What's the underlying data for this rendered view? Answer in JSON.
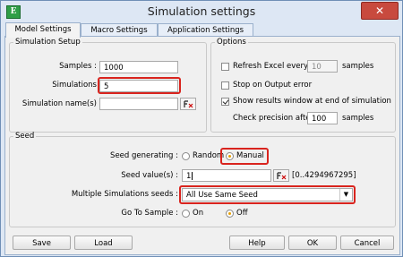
{
  "window": {
    "title": "Simulation settings",
    "app_icon_letter": "E",
    "close_glyph": "✕"
  },
  "tabs": [
    {
      "label": "Model Settings",
      "active": true
    },
    {
      "label": "Macro Settings",
      "active": false
    },
    {
      "label": "Application Settings",
      "active": false
    }
  ],
  "simulation_setup": {
    "legend": "Simulation Setup",
    "samples_label": "Samples :",
    "samples_value": "1000",
    "simulations_label": "Simulations",
    "simulations_value": "5",
    "simulation_names_label": "Simulation name(s)",
    "simulation_names_value": ""
  },
  "options": {
    "legend": "Options",
    "refresh_label": "Refresh Excel every",
    "refresh_checked": false,
    "refresh_value": "10",
    "refresh_unit": "samples",
    "stop_label": "Stop on Output error",
    "stop_checked": false,
    "show_results_label": "Show results window at end of simulation",
    "show_results_checked": true,
    "check_precision_label": "Check precision after",
    "check_precision_value": "100",
    "check_precision_unit": "samples"
  },
  "seed": {
    "legend": "Seed",
    "generating_label": "Seed generating :",
    "random_label": "Random",
    "manual_label": "Manual",
    "selected": "Manual",
    "value_label": "Seed value(s) :",
    "value": "1",
    "range_hint": "[0..4294967295]",
    "multi_label": "Multiple Simulations seeds :",
    "multi_value": "All Use Same Seed",
    "goto_label": "Go To Sample :",
    "on_label": "On",
    "off_label": "Off",
    "goto_selected": "Off"
  },
  "footer": {
    "save": "Save",
    "load": "Load",
    "help": "Help",
    "ok": "OK",
    "cancel": "Cancel"
  },
  "colors": {
    "highlight": "#d9241e",
    "radio_selected": "#e8a000",
    "close_button": "#c84a3e"
  }
}
